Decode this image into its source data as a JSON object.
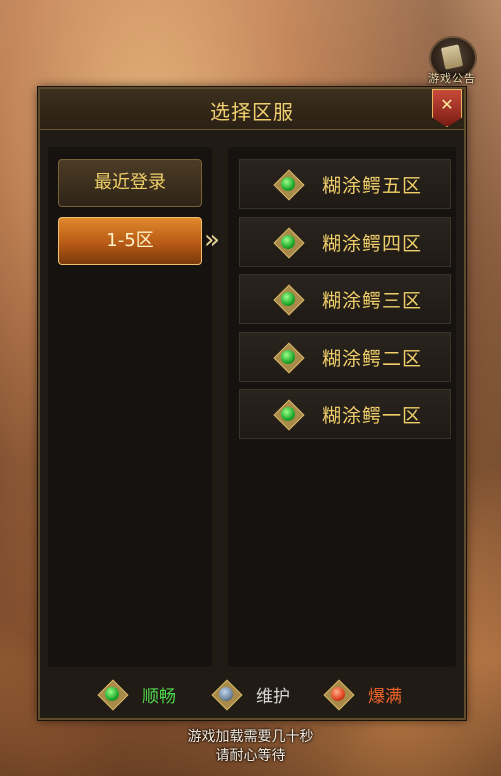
{
  "notice": {
    "label": "游戏公告",
    "icon": "scroll-icon"
  },
  "dialog": {
    "title": "选择区服",
    "close_icon": "close-icon"
  },
  "tabs": [
    {
      "label": "最近登录",
      "selected": false
    },
    {
      "label": "1-5区",
      "selected": true
    }
  ],
  "servers": [
    {
      "name": "糊涂鳄五区",
      "status": "smooth"
    },
    {
      "name": "糊涂鳄四区",
      "status": "smooth"
    },
    {
      "name": "糊涂鳄三区",
      "status": "smooth"
    },
    {
      "name": "糊涂鳄二区",
      "status": "smooth"
    },
    {
      "name": "糊涂鳄一区",
      "status": "smooth"
    }
  ],
  "legend": [
    {
      "label": "顺畅",
      "color": "#2ecf3a",
      "text_color": "#4fd84a"
    },
    {
      "label": "维护",
      "color": "#6f86a0",
      "text_color": "#d8d8d8"
    },
    {
      "label": "爆满",
      "color": "#e0421c",
      "text_color": "#f2642a"
    }
  ],
  "loading": {
    "line1": "游戏加载需要几十秒",
    "line2": "请耐心等待"
  },
  "colors": {
    "gold_text": "#f0cf6a",
    "gem_smooth": "#2ecf3a"
  }
}
